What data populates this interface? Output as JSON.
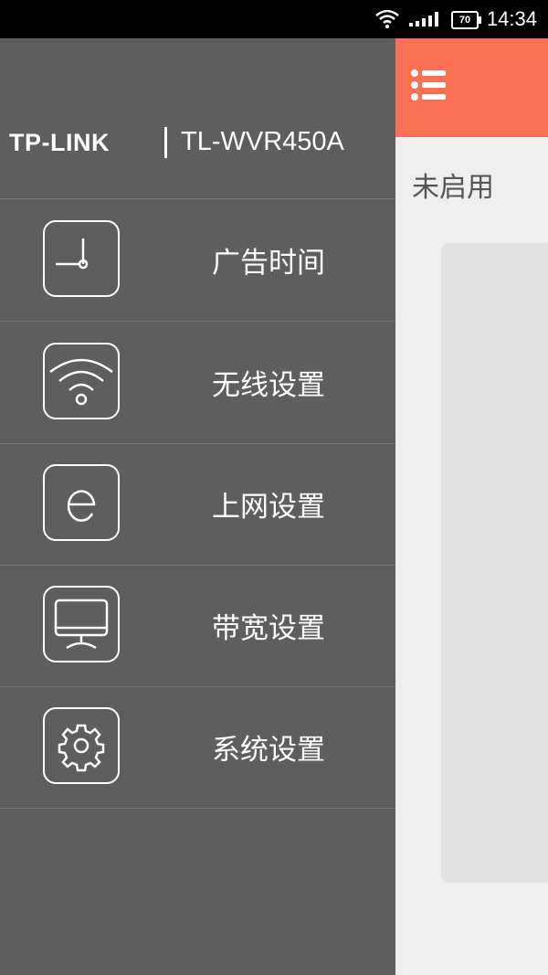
{
  "status_bar": {
    "time": "14:34",
    "battery": "70"
  },
  "drawer": {
    "brand_logo": "TP-LINK",
    "model": "TL-WVR450A",
    "items": [
      {
        "label": "广告时间",
        "icon": "clock-icon"
      },
      {
        "label": "无线设置",
        "icon": "wifi-icon"
      },
      {
        "label": "上网设置",
        "icon": "internet-e-icon"
      },
      {
        "label": "带宽设置",
        "icon": "monitor-icon"
      },
      {
        "label": "系统设置",
        "icon": "gear-icon"
      }
    ]
  },
  "main": {
    "status": "未启用",
    "header_color": "#fb6f52"
  }
}
